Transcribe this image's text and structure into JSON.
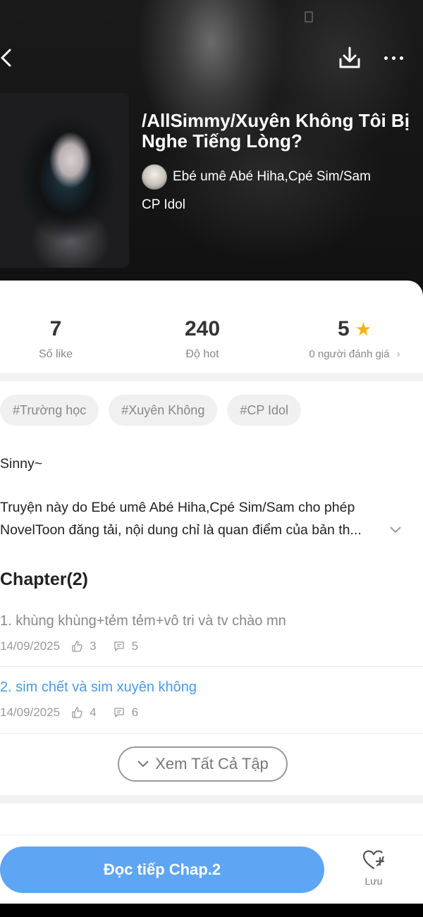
{
  "header": {
    "title": "/AllSimmy/Xuyên Không Tôi Bị Nghe Tiếng Lòng?",
    "author": "Ebé umê Abé Hiha,Cpé Sim/Sam",
    "category": "CP Idol"
  },
  "stats": {
    "likes_value": "7",
    "likes_label": "Số like",
    "hot_value": "240",
    "hot_label": "Độ hot",
    "rating_value": "5",
    "rating_label": "0 người đánh giá"
  },
  "tags": [
    "#Trường học",
    "#Xuyên Không",
    "#CP Idol"
  ],
  "description": {
    "line1": "Sinny~",
    "line2": "Truyện này do Ebé umê Abé Hiha,Cpé Sim/Sam cho phép NovelToon đăng tải, nội dung chỉ là quan điểm của bản th..."
  },
  "chapters": {
    "heading": "Chapter(2)",
    "items": [
      {
        "title": "1. khùng khùng+tẻm tẻm+vô tri và tv chào mn",
        "date": "14/09/2025",
        "likes": "3",
        "comments": "5"
      },
      {
        "title": "2. sim chết và sim xuyên không",
        "date": "14/09/2025",
        "likes": "4",
        "comments": "6"
      }
    ],
    "view_all": "Xem Tất Cả Tập"
  },
  "bottom": {
    "read_button": "Đọc tiếp Chap.2",
    "save_label": "Lưu"
  },
  "colors": {
    "accent": "#5ea5f3",
    "chapter_active": "#4a9ae6",
    "star": "#f5b400"
  }
}
